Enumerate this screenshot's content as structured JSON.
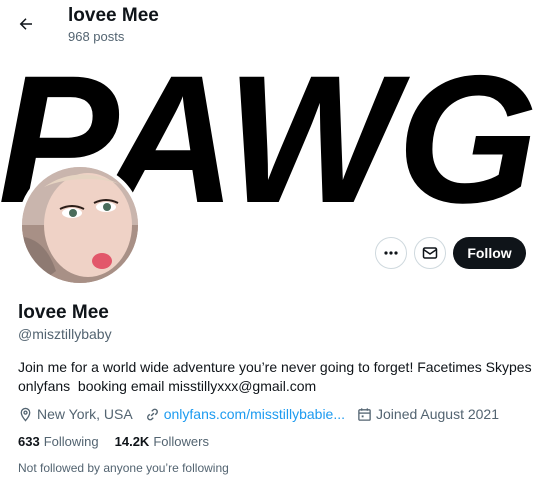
{
  "header": {
    "name": "lovee Mee",
    "posts": "968 posts"
  },
  "banner": {
    "text": "PAWG"
  },
  "actions": {
    "follow_label": "Follow"
  },
  "profile": {
    "name": "lovee Mee",
    "handle": "@misztillybaby",
    "bio": "Join me for a world wide adventure you’re never going to forget! Facetimes Skypes\nonlyfans  booking email misstillyxxx@gmail.com",
    "location": "New York, USA",
    "link": "onlyfans.com/misstillybabie...",
    "joined": "Joined August 2021"
  },
  "stats": {
    "following_count": "633",
    "following_label": "Following",
    "followers_count": "14.2K",
    "followers_label": "Followers"
  },
  "footnote": "Not followed by anyone you’re following",
  "colors": {
    "text": "#0f1419",
    "secondary": "#536471",
    "link": "#1d9bf0",
    "follow_button": "#0f1419"
  },
  "icons": [
    "arrow-left-icon",
    "more-icon",
    "envelope-icon",
    "location-pin-icon",
    "link-icon",
    "calendar-icon"
  ]
}
